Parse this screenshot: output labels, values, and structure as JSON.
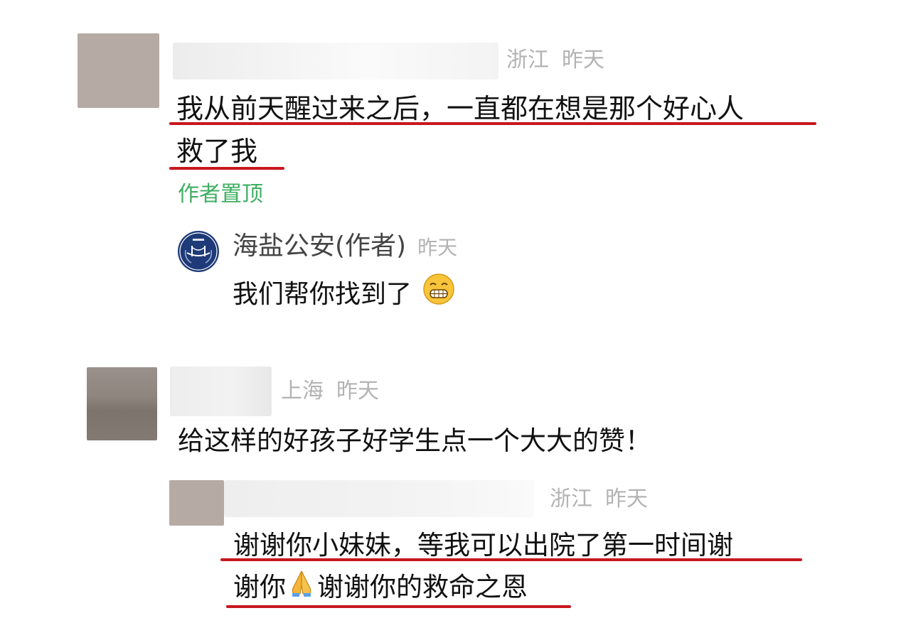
{
  "comments": [
    {
      "location": "浙江",
      "time": "昨天",
      "text_line1": "我从前天醒过来之后，一直都在想是那个好心人",
      "text_line2": "救了我",
      "pinned_label": "作者置顶",
      "reply": {
        "author": "海盐公安(作者)",
        "time": "昨天",
        "text": "我们帮你找到了",
        "emoji": "grinning-face-icon"
      }
    },
    {
      "location": "上海",
      "time": "昨天",
      "text": "给这样的好孩子好学生点一个大大的赞！",
      "reply": {
        "location": "浙江",
        "time": "昨天",
        "text_line1": "谢谢你小妹妹，等我可以出院了第一时间谢",
        "text_line2_a": "谢你",
        "text_line2_b": "谢谢你的救命之恩",
        "emoji": "folded-hands-icon"
      }
    }
  ],
  "colors": {
    "underline": "#c8171e",
    "pinned": "#3fae62",
    "meta": "#b3b3b3"
  }
}
